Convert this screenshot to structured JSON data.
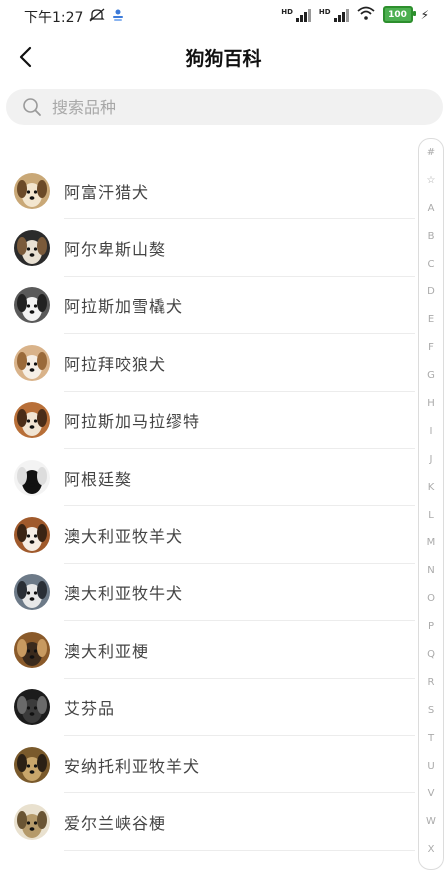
{
  "status_bar": {
    "time": "下午1:27",
    "hd1": "HD",
    "hd2": "HD",
    "battery": "100"
  },
  "header": {
    "title": "狗狗百科"
  },
  "search": {
    "placeholder": "搜索品种"
  },
  "breeds": [
    {
      "name": "阿富汗猎犬",
      "colors": [
        "#c9a877",
        "#f3e6cf",
        "#6b4a28"
      ]
    },
    {
      "name": "阿尔卑斯山獒",
      "colors": [
        "#2b2b2b",
        "#e8e0d2",
        "#7a5a3a"
      ]
    },
    {
      "name": "阿拉斯加雪橇犬",
      "colors": [
        "#5a5a5a",
        "#f4f4f4",
        "#222222"
      ]
    },
    {
      "name": "阿拉拜咬狼犬",
      "colors": [
        "#d9b38a",
        "#f6efe6",
        "#9a6a3a"
      ]
    },
    {
      "name": "阿拉斯加马拉缪特",
      "colors": [
        "#b86f38",
        "#f1e4d2",
        "#4a2d18"
      ]
    },
    {
      "name": "阿根廷獒",
      "colors": [
        "#f3f3f3",
        "#111111",
        "#dddddd"
      ]
    },
    {
      "name": "澳大利亚牧羊犬",
      "colors": [
        "#a05a2c",
        "#f5ede4",
        "#3a2414"
      ]
    },
    {
      "name": "澳大利亚牧牛犬",
      "colors": [
        "#6d7a88",
        "#e8e8e8",
        "#2a2f36"
      ]
    },
    {
      "name": "澳大利亚梗",
      "colors": [
        "#8a5a2a",
        "#3a2a1c",
        "#c89a60"
      ]
    },
    {
      "name": "艾芬品",
      "colors": [
        "#1c1c1c",
        "#3b3b3b",
        "#6a6a6a"
      ]
    },
    {
      "name": "安纳托利亚牧羊犬",
      "colors": [
        "#7a5a2c",
        "#c9a66b",
        "#2b2015"
      ]
    },
    {
      "name": "爱尔兰峡谷梗",
      "colors": [
        "#e9e1cf",
        "#b59a6a",
        "#6a5534"
      ]
    }
  ],
  "index_letters": [
    "#",
    "☆",
    "A",
    "B",
    "C",
    "D",
    "E",
    "F",
    "G",
    "H",
    "I",
    "J",
    "K",
    "L",
    "M",
    "N",
    "O",
    "P",
    "Q",
    "R",
    "S",
    "T",
    "U",
    "V",
    "W",
    "X"
  ]
}
